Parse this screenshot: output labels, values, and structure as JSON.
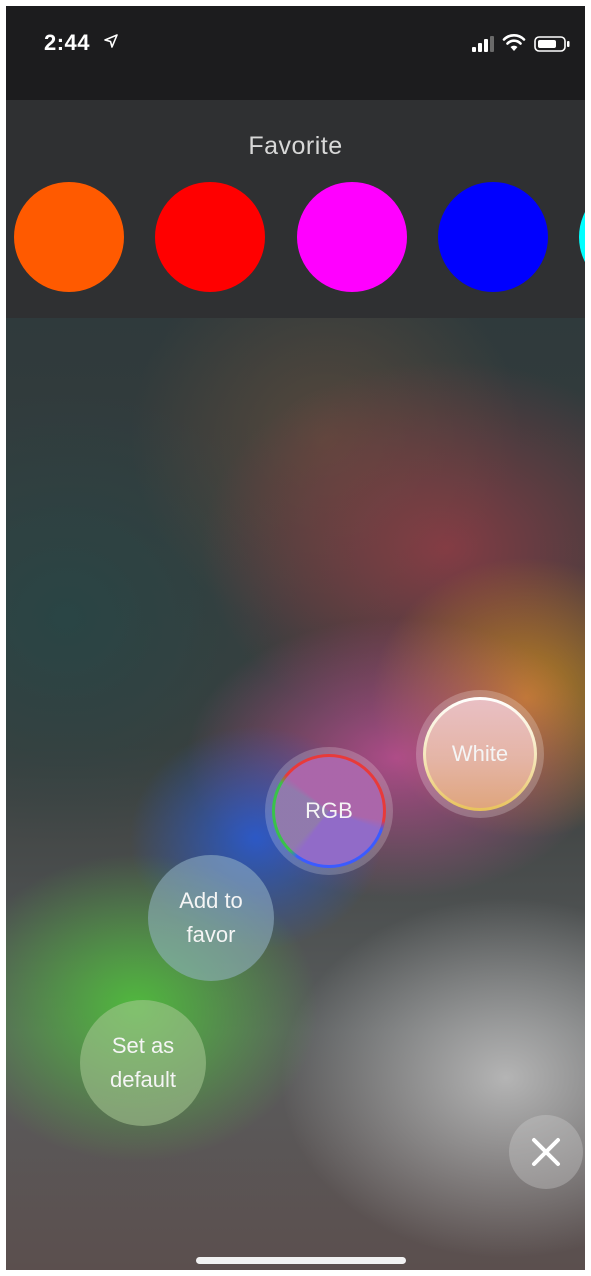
{
  "status_bar": {
    "time": "2:44",
    "icons": [
      "location-arrow-icon",
      "cellular-signal-icon",
      "wifi-icon",
      "battery-icon"
    ]
  },
  "favorite": {
    "title": "Favorite",
    "swatches": [
      {
        "color": "#ff5a00"
      },
      {
        "color": "#ff0000"
      },
      {
        "color": "#ff00ff"
      },
      {
        "color": "#0000ff"
      },
      {
        "color": "#00ffff"
      }
    ]
  },
  "modes": {
    "white_label": "White",
    "rgb_label": "RGB",
    "add_favor_label": "Add to\nfavor",
    "set_default_label": "Set as\ndefault"
  },
  "controls": {
    "close_icon": "close-icon"
  },
  "colors": {
    "status_bar_bg": "#1c1c1e",
    "favorite_panel_bg": "#2f3032",
    "label_text": "#f5f5f5"
  }
}
